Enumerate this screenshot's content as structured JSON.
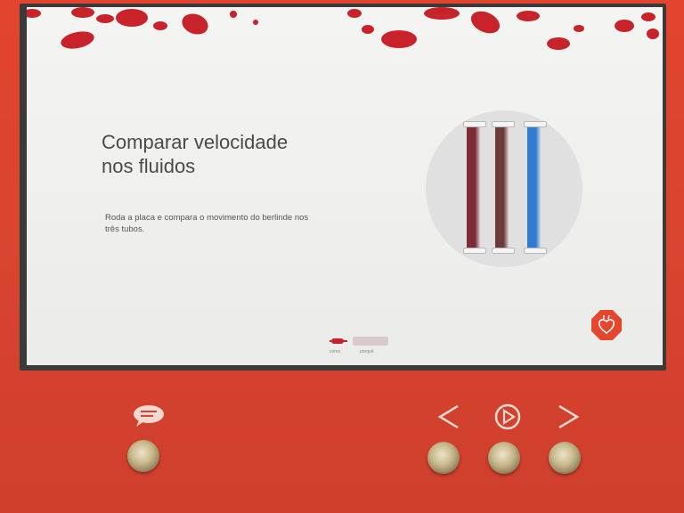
{
  "content": {
    "title_line1": "Comparar velocidade",
    "title_line2": "nos fluidos",
    "instructions_line1": "Roda a placa e compara o movimento do berlinde nos",
    "instructions_line2": "três tubos."
  },
  "pager": {
    "labels": [
      "como",
      "porquê"
    ],
    "current": 1
  },
  "tubes": [
    {
      "color": "#7d2b34"
    },
    {
      "color": "#6b3b3b"
    },
    {
      "color": "#2f7bd0"
    }
  ],
  "theme": {
    "accent": "#e4472e",
    "blob_color": "#c8222b"
  },
  "icons": {
    "chat": "chat-icon",
    "previous": "chevron-left-icon",
    "play": "play-icon",
    "next": "chevron-right-icon",
    "badge": "heart-icon"
  }
}
